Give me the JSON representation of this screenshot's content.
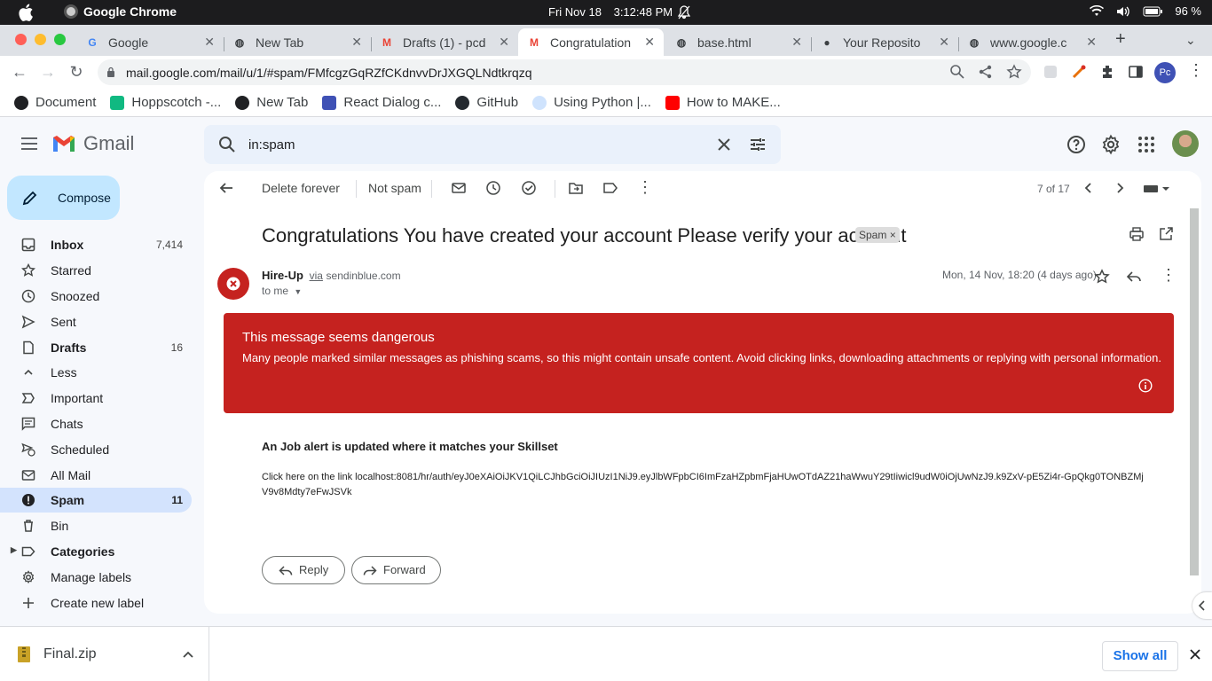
{
  "menubar": {
    "app_name": "Google Chrome",
    "date": "Fri Nov 18",
    "time": "3:12:48 PM",
    "battery": "96 %"
  },
  "tabs": [
    {
      "title": "Google",
      "active": false
    },
    {
      "title": "New Tab",
      "active": false
    },
    {
      "title": "Drafts (1) - pcd",
      "active": false
    },
    {
      "title": "Congratulation",
      "active": true
    },
    {
      "title": "base.html",
      "active": false
    },
    {
      "title": "Your Reposito",
      "active": false
    },
    {
      "title": "www.google.c",
      "active": false
    }
  ],
  "address": {
    "url": "mail.google.com/mail/u/1/#spam/FMfcgzGqRZfCKdnvvDrJXGQLNdtkrqzq",
    "profile_initials": "Pc"
  },
  "bookmarks": [
    {
      "label": "Document",
      "color": "#202124"
    },
    {
      "label": "Hoppscotch -...",
      "color": "#10b981"
    },
    {
      "label": "New Tab",
      "color": "#202124"
    },
    {
      "label": "React Dialog c...",
      "color": "#3f51b5"
    },
    {
      "label": "GitHub",
      "color": "#24292f"
    },
    {
      "label": "Using Python |...",
      "color": "#8ab4f8"
    },
    {
      "label": "How to MAKE...",
      "color": "#ff0000"
    }
  ],
  "gmail": {
    "brand": "Gmail",
    "search_value": "in:spam",
    "compose_label": "Compose"
  },
  "sidebar": {
    "items": [
      {
        "label": "Inbox",
        "count": "7,414",
        "icon": "inbox-icon"
      },
      {
        "label": "Starred",
        "count": "",
        "icon": "star-icon"
      },
      {
        "label": "Snoozed",
        "count": "",
        "icon": "clock-icon"
      },
      {
        "label": "Sent",
        "count": "",
        "icon": "send-icon"
      },
      {
        "label": "Drafts",
        "count": "16",
        "icon": "draft-icon"
      },
      {
        "label": "Less",
        "count": "",
        "icon": "chevron-up-icon"
      },
      {
        "label": "Important",
        "count": "",
        "icon": "important-icon"
      },
      {
        "label": "Chats",
        "count": "",
        "icon": "chat-icon"
      },
      {
        "label": "Scheduled",
        "count": "",
        "icon": "scheduled-icon"
      },
      {
        "label": "All Mail",
        "count": "",
        "icon": "all-mail-icon"
      },
      {
        "label": "Spam",
        "count": "11",
        "icon": "spam-icon"
      },
      {
        "label": "Bin",
        "count": "",
        "icon": "bin-icon"
      },
      {
        "label": "Categories",
        "count": "",
        "icon": "label-icon"
      },
      {
        "label": "Manage labels",
        "count": "",
        "icon": "gear-icon"
      },
      {
        "label": "Create new label",
        "count": "",
        "icon": "plus-icon"
      }
    ]
  },
  "toolbar": {
    "delete_forever": "Delete forever",
    "not_spam": "Not spam",
    "pager": "7 of 17"
  },
  "message": {
    "subject": "Congratulations You have created your account Please verify your account",
    "badge": "Spam",
    "sender_name": "Hire-Up",
    "via_label": "via",
    "sender_domain": "sendinblue.com",
    "to_label": "to me",
    "date": "Mon, 14 Nov, 18:20 (4 days ago)",
    "warning_title": "This message seems dangerous",
    "warning_text": "Many people marked similar messages as phishing scams, so this might contain unsafe content. Avoid clicking links, downloading attachments or replying with personal information.",
    "body_title": "An Job alert is updated where it matches your Skillset",
    "body_text": "Click here on the link localhost:8081/hr/auth/eyJ0eXAiOiJKV1QiLCJhbGciOiJIUzI1NiJ9.eyJlbWFpbCI6ImFzaHZpbmFjaHUwOTdAZ21haWwuY29tIiwicl9udW0iOjUwNzJ9.k9ZxV-pE5Zi4r-GpQkg0TONBZMjV9v8Mdty7eFwJSVk",
    "reply_label": "Reply",
    "forward_label": "Forward"
  },
  "downloads": {
    "file_name": "Final.zip",
    "show_all": "Show all"
  },
  "colors": {
    "warning": "#c5221f",
    "active_nav": "#d3e3fd",
    "compose": "#c2e7ff",
    "link": "#1a73e8"
  }
}
